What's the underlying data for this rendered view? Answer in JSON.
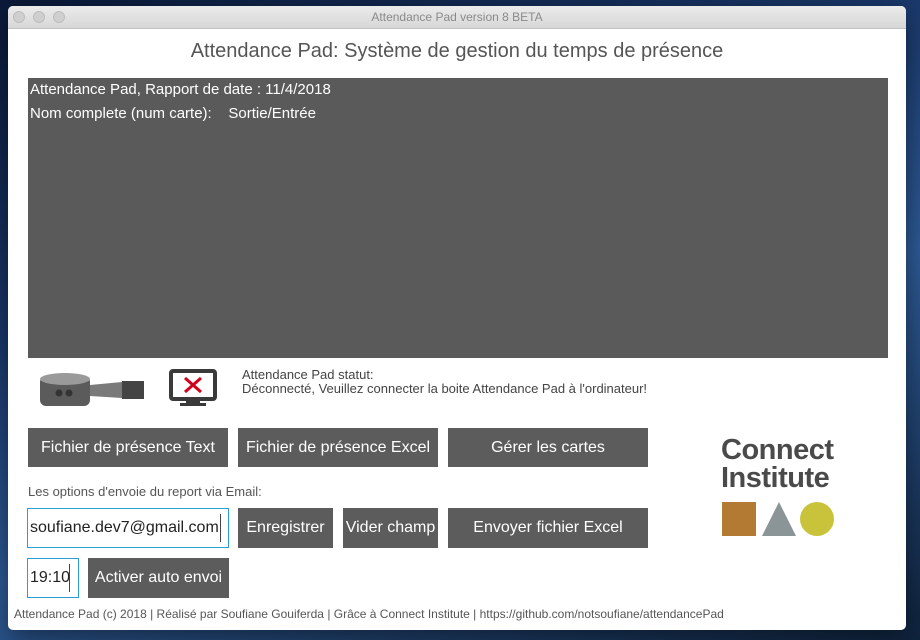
{
  "window": {
    "title": "Attendance Pad version 8 BETA"
  },
  "app": {
    "title": "Attendance Pad: Système de gestion du temps de présence"
  },
  "report": {
    "line1": "Attendance Pad, Rapport de date : 11/4/2018",
    "line2_label": "Nom complete (num carte):",
    "line2_value": "Sortie/Entrée"
  },
  "status": {
    "title": "Attendance Pad statut:",
    "message": "Déconnecté, Veuillez connecter la boite Attendance Pad à l'ordinateur!"
  },
  "buttons": {
    "text_file": "Fichier de présence Text",
    "excel_file": "Fichier de présence Excel",
    "manage_cards": "Gérer les cartes",
    "save": "Enregistrer",
    "clear": "Vider champ",
    "send_excel": "Envoyer fichier Excel",
    "auto_send": "Activer auto envoi"
  },
  "email": {
    "label": "Les options d'envoie du report via Email:",
    "value": "soufiane.dev7@gmail.com"
  },
  "time": {
    "value": "19:10"
  },
  "logo": {
    "line1": "Connect",
    "line2": "Institute"
  },
  "footer": {
    "text": "Attendance Pad (c) 2018 | Réalisé par Soufiane Gouiferda | Grâce à Connect Institute | https://github.com/notsoufiane/attendancePad"
  },
  "colors": {
    "button_bg": "#5c5c5c",
    "report_bg": "#5a5a5a",
    "input_border": "#2a9fd6",
    "disconnected_x": "#d0021b",
    "logo_square": "#b37a33",
    "logo_triangle": "#8b9497",
    "logo_circle": "#c8c33a"
  },
  "icons": {
    "device": "usb-device-icon",
    "disconnected": "monitor-disconnected-icon"
  }
}
